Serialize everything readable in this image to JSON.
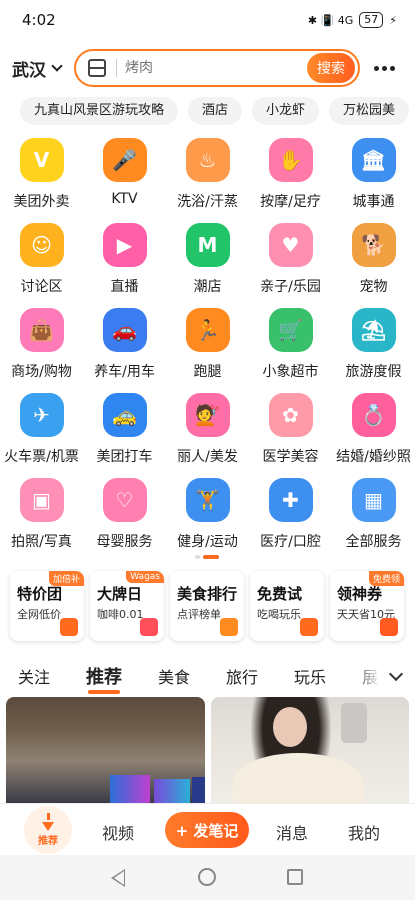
{
  "status_bar": {
    "time": "4:02",
    "indicators": "✱ 📳 4G",
    "battery": "57"
  },
  "header": {
    "city": "武汉",
    "search_placeholder": "烤肉",
    "search_button": "搜索"
  },
  "hot_tags": [
    "九真山风景区游玩攻略",
    "酒店",
    "小龙虾",
    "万松园美"
  ],
  "categories": [
    [
      {
        "label": "美团外卖",
        "icon": "kangaroo-icon",
        "color": "#ffd21e",
        "glyph": "V"
      },
      {
        "label": "KTV",
        "icon": "microphone-icon",
        "color": "#ff8a1f",
        "glyph": "🎤"
      },
      {
        "label": "洗浴/汗蒸",
        "icon": "bath-icon",
        "color": "#ff9a4a",
        "glyph": "♨"
      },
      {
        "label": "按摩/足疗",
        "icon": "massage-icon",
        "color": "#ff7aa8",
        "glyph": "✋"
      },
      {
        "label": "城事通",
        "icon": "city-icon",
        "color": "#3d8ff0",
        "glyph": "🏛"
      }
    ],
    [
      {
        "label": "讨论区",
        "icon": "chat-bubble-icon",
        "color": "#ffb21e",
        "glyph": "☺"
      },
      {
        "label": "直播",
        "icon": "live-video-icon",
        "color": "#ff5fa6",
        "glyph": "▶"
      },
      {
        "label": "潮店",
        "icon": "trend-shop-icon",
        "color": "#22c46a",
        "glyph": "M"
      },
      {
        "label": "亲子/乐园",
        "icon": "parent-child-icon",
        "color": "#ff8fb0",
        "glyph": "♥"
      },
      {
        "label": "宠物",
        "icon": "dog-icon",
        "color": "#f0a040",
        "glyph": "🐕"
      }
    ],
    [
      {
        "label": "商场/购物",
        "icon": "shopping-bag-icon",
        "color": "#ff7ab8",
        "glyph": "👜"
      },
      {
        "label": "养车/用车",
        "icon": "car-icon",
        "color": "#3b7df0",
        "glyph": "🚗"
      },
      {
        "label": "跑腿",
        "icon": "runner-icon",
        "color": "#ff8a1f",
        "glyph": "🏃"
      },
      {
        "label": "小象超市",
        "icon": "supermarket-icon",
        "color": "#38c16a",
        "glyph": "🛒"
      },
      {
        "label": "旅游度假",
        "icon": "beach-icon",
        "color": "#28b6c8",
        "glyph": "⛱"
      }
    ],
    [
      {
        "label": "火车票/机票",
        "icon": "plane-icon",
        "color": "#3aa0f0",
        "glyph": "✈"
      },
      {
        "label": "美团打车",
        "icon": "taxi-icon",
        "color": "#2f86f0",
        "glyph": "🚕"
      },
      {
        "label": "丽人/美发",
        "icon": "beauty-icon",
        "color": "#ff6ea6",
        "glyph": "💇"
      },
      {
        "label": "医学美容",
        "icon": "skincare-icon",
        "color": "#ff9aa8",
        "glyph": "✿"
      },
      {
        "label": "结婚/婚纱照",
        "icon": "ring-icon",
        "color": "#ff5f9a",
        "glyph": "💍"
      }
    ],
    [
      {
        "label": "拍照/写真",
        "icon": "photo-frame-icon",
        "color": "#ff8fb6",
        "glyph": "▣"
      },
      {
        "label": "母婴服务",
        "icon": "mother-baby-icon",
        "color": "#ff80b0",
        "glyph": "♡"
      },
      {
        "label": "健身/运动",
        "icon": "dumbbell-icon",
        "color": "#3d8ff0",
        "glyph": "🏋"
      },
      {
        "label": "医疗/口腔",
        "icon": "medical-icon",
        "color": "#3d8ff0",
        "glyph": "✚"
      },
      {
        "label": "全部服务",
        "icon": "all-services-icon",
        "color": "#4a9af5",
        "glyph": "▦"
      }
    ]
  ],
  "promos": [
    {
      "title": "特价团",
      "sub": "全网低价",
      "badge": "加倍补",
      "mini_color": "#ff6a1f"
    },
    {
      "title": "大牌日",
      "sub": "咖啡0.01",
      "badge": "Wagas",
      "mini_color": "#ff4f5a"
    },
    {
      "title": "美食排行",
      "sub": "点评榜单",
      "badge": "",
      "mini_color": "#ff8a1f"
    },
    {
      "title": "免费试",
      "sub": "吃喝玩乐",
      "badge": "",
      "mini_color": "#ff6a1f"
    },
    {
      "title": "领神券",
      "sub": "天天省10元",
      "badge": "免费领",
      "mini_color": "#ff5a1f"
    }
  ],
  "feed_tabs": [
    "关注",
    "推荐",
    "美食",
    "旅行",
    "玩乐",
    "展"
  ],
  "active_feed_tab": "推荐",
  "bottom_nav": {
    "home": "推荐",
    "video": "视频",
    "post": "+ 发笔记",
    "messages": "消息",
    "mine": "我的"
  },
  "colors": {
    "accent": "#ff6a1f"
  }
}
